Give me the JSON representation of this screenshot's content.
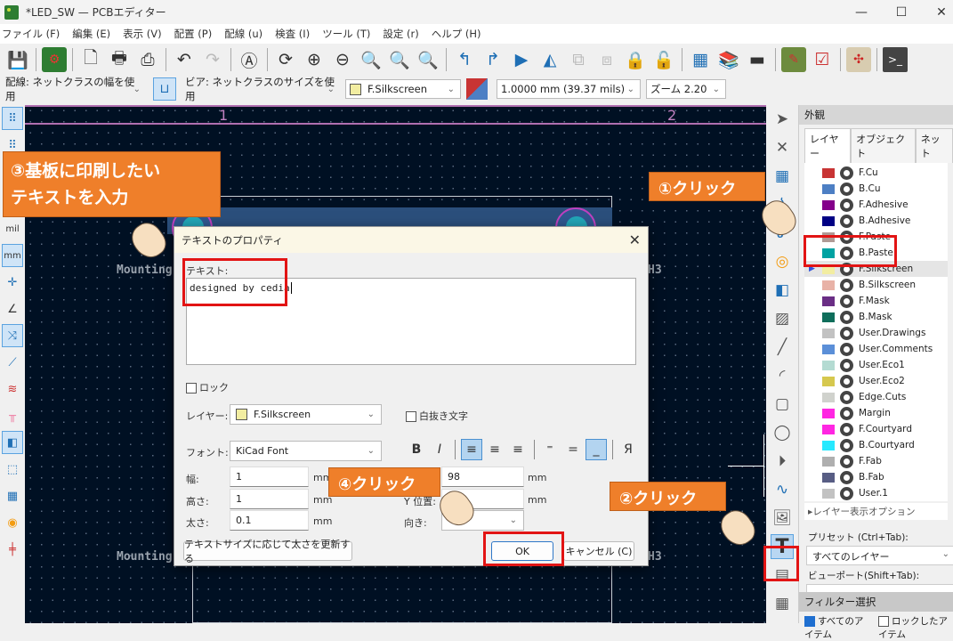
{
  "window": {
    "title": "*LED_SW — PCBエディター",
    "controls": {
      "minimize": "—",
      "maximize": "☐",
      "close": "✕"
    }
  },
  "menu": [
    "ファイル (F)",
    "編集 (E)",
    "表示 (V)",
    "配置 (P)",
    "配線 (u)",
    "検査 (I)",
    "ツール (T)",
    "設定 (r)",
    "ヘルプ (H)"
  ],
  "toolbar": {
    "icons": [
      "save-icon",
      "board-setup-icon",
      "page-settings-icon",
      "print-icon",
      "plot-icon",
      "undo-icon",
      "redo-icon",
      "find-icon",
      "refresh-icon",
      "zoom-in-icon",
      "zoom-out-icon",
      "zoom-fit-icon",
      "zoom-objects-icon",
      "zoom-selection-icon",
      "rotate-ccw-icon",
      "rotate-cw-icon",
      "flip-icon",
      "mirror-icon",
      "group-icon",
      "ungroup-icon",
      "lock-icon",
      "unlock-icon",
      "footprint-editor-icon",
      "footprint-browser-icon",
      "update-pcb-icon",
      "schematic-icon",
      "drc-icon",
      "net-inspector-icon",
      "scripting-console-icon"
    ]
  },
  "toolbar2": {
    "track_width": "配線: ネットクラスの幅を使用",
    "via_size": "ビア: ネットクラスのサイズを使用",
    "layer": "F.Silkscreen",
    "layer_color": "#f2eda1",
    "grid": "1.0000 mm (39.37 mils)",
    "zoom": "ズーム 2.20"
  },
  "canvas": {
    "ruler_labels": [
      "1",
      "2"
    ],
    "mounting_labels": [
      "Mounting",
      "H3",
      "Mounting",
      "H3"
    ]
  },
  "left_tools": {
    "units_mil": "mil",
    "units_mm": "mm"
  },
  "appearance": {
    "title": "外観",
    "tabs": [
      "レイヤー",
      "オブジェクト",
      "ネット"
    ],
    "active_tab": "レイヤー",
    "layers": [
      {
        "name": "F.Cu",
        "color": "#c83434"
      },
      {
        "name": "B.Cu",
        "color": "#4d7fc4"
      },
      {
        "name": "F.Adhesive",
        "color": "#84008a"
      },
      {
        "name": "B.Adhesive",
        "color": "#000084"
      },
      {
        "name": "F.Paste",
        "color": "#b09a95"
      },
      {
        "name": "B.Paste",
        "color": "#00a2a2"
      },
      {
        "name": "F.Silkscreen",
        "color": "#f2eda1",
        "selected": true
      },
      {
        "name": "B.Silkscreen",
        "color": "#e8b2a7"
      },
      {
        "name": "F.Mask",
        "color": "#6a2e85"
      },
      {
        "name": "B.Mask",
        "color": "#0f6e5b"
      },
      {
        "name": "User.Drawings",
        "color": "#c2c2c2"
      },
      {
        "name": "User.Comments",
        "color": "#5b8fd8"
      },
      {
        "name": "User.Eco1",
        "color": "#b4dbd2"
      },
      {
        "name": "User.Eco2",
        "color": "#d6c84e"
      },
      {
        "name": "Edge.Cuts",
        "color": "#d0d2cd"
      },
      {
        "name": "Margin",
        "color": "#ff26e2"
      },
      {
        "name": "F.Courtyard",
        "color": "#ff26e2"
      },
      {
        "name": "B.Courtyard",
        "color": "#26e9ff"
      },
      {
        "name": "F.Fab",
        "color": "#afafaf"
      },
      {
        "name": "B.Fab",
        "color": "#585d84"
      },
      {
        "name": "User.1",
        "color": "#c2c2c2"
      }
    ],
    "layer_options": "レイヤー表示オプション",
    "preset_label": "プリセット (Ctrl+Tab):",
    "preset_value": "すべてのレイヤー",
    "viewport_label": "ビューポート(Shift+Tab):",
    "viewport_value": "---",
    "filter_title": "フィルター選択",
    "filter_all": "すべてのアイテム",
    "filter_locked": "ロックしたアイテム"
  },
  "dialog": {
    "title": "テキストのプロパティ",
    "text_label": "テキスト:",
    "text_value": "designed by cedia",
    "lock_label": "ロック",
    "layer_label": "レイヤー:",
    "layer_value": "F.Silkscreen",
    "knockout_label": "白抜き文字",
    "font_label": "フォント:",
    "font_value": "KiCad Font",
    "width_label": "幅:",
    "width_value": "1",
    "height_label": "高さ:",
    "height_value": "1",
    "thickness_label": "太さ:",
    "thickness_value": "0.1",
    "unit": "mm",
    "xpos_value": "98",
    "ypos_label": "Y 位置:",
    "orientation_label": "向き:",
    "update_thickness_btn": "テキストサイズに応じて太さを更新する",
    "ok": "OK",
    "cancel": "キャンセル (C)",
    "format": {
      "bold": "B",
      "italic": "I",
      "mirror": "Я"
    }
  },
  "annotations": {
    "step1": "①クリック",
    "step2": "②クリック",
    "step3_line1": "③基板に印刷したい",
    "step3_line2": "テキストを入力",
    "step4": "④クリック",
    "callout_color": "#ef7f2a",
    "highlight_color": "#e21414"
  }
}
